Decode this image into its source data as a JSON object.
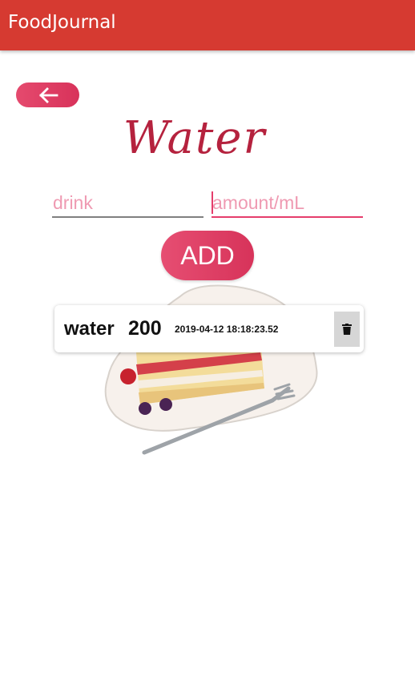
{
  "app_bar": {
    "title": "FoodJournal"
  },
  "colors": {
    "app_bar": "#d63a31",
    "accent": "#e54a6e",
    "placeholder": "#ef9ab2"
  },
  "back_button": {
    "icon": "arrow-left-icon"
  },
  "heading": {
    "text": "Water"
  },
  "form": {
    "drink_placeholder": "drink",
    "drink_value": "",
    "amount_placeholder": "amount/mL",
    "amount_value": "",
    "add_label": "ADD"
  },
  "entries": [
    {
      "name": "water",
      "amount": "200",
      "timestamp": "2019-04-12 18:18:23.52",
      "delete_icon": "trash-icon"
    }
  ]
}
